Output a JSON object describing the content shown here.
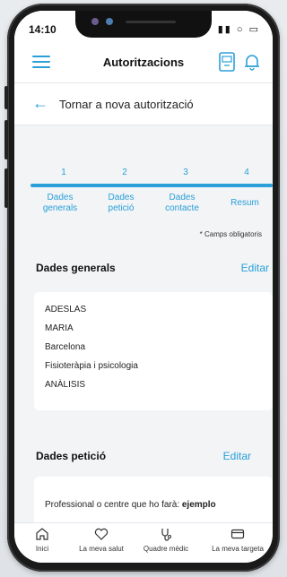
{
  "status_bar": {
    "time": "14:10",
    "icons_text": "▮▮ ○ ▭"
  },
  "header": {
    "title": "Autoritzacions"
  },
  "back": {
    "label": "Tornar a nova autorització"
  },
  "stepper": {
    "steps": [
      {
        "number": "1",
        "label": "Dades generals"
      },
      {
        "number": "2",
        "label": "Dades petició"
      },
      {
        "number": "3",
        "label": "Dades contacte"
      },
      {
        "number": "4",
        "label": "Resum"
      }
    ],
    "required_note": "* Camps obligatoris"
  },
  "general": {
    "title": "Dades generals",
    "edit_label": "Editar",
    "lines": [
      "ADESLAS",
      "MARIA",
      "Barcelona",
      "Fisioteràpia i psicologia",
      "ANÀLISIS"
    ]
  },
  "request": {
    "title": "Dades petició",
    "edit_label": "Editar",
    "professional_label": "Professional o centre que ho farà:",
    "professional_value": "ejemplo"
  },
  "tabbar": {
    "tabs": [
      {
        "label": "Inici",
        "icon": "home-icon"
      },
      {
        "label": "La meva salut",
        "icon": "heart-icon"
      },
      {
        "label": "Quadre mèdic",
        "icon": "stethoscope-icon"
      },
      {
        "label": "La meva targeta",
        "icon": "card-icon"
      }
    ]
  },
  "colors": {
    "accent": "#2a9fd8",
    "background": "#f2f4f6",
    "card": "#ffffff"
  }
}
